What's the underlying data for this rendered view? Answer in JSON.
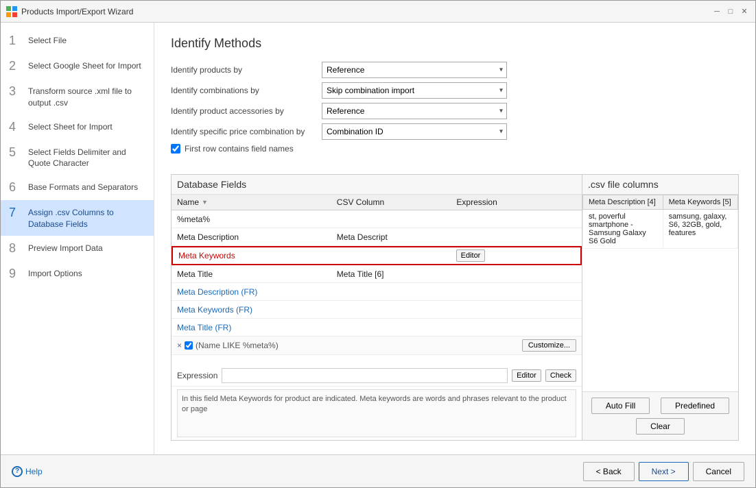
{
  "window": {
    "title": "Products Import/Export Wizard"
  },
  "sidebar": {
    "items": [
      {
        "num": "1",
        "label": "Select File",
        "active": false
      },
      {
        "num": "2",
        "label": "Select Google Sheet for Import",
        "active": false
      },
      {
        "num": "3",
        "label": "Transform source .xml file to output .csv",
        "active": false
      },
      {
        "num": "4",
        "label": "Select Sheet for Import",
        "active": false
      },
      {
        "num": "5",
        "label": "Select Fields Delimiter and Quote Character",
        "active": false
      },
      {
        "num": "6",
        "label": "Base Formats and Separators",
        "active": false
      },
      {
        "num": "7",
        "label": "Assign .csv Columns to Database Fields",
        "active": true
      },
      {
        "num": "8",
        "label": "Preview Import Data",
        "active": false
      },
      {
        "num": "9",
        "label": "Import Options",
        "active": false
      }
    ]
  },
  "main": {
    "page_title": "Identify Methods",
    "form": {
      "row1_label": "Identify products by",
      "row1_value": "Reference",
      "row2_label": "Identify combinations by",
      "row2_value": "Skip combination import",
      "row3_label": "Identify product accessories by",
      "row3_value": "Reference",
      "row4_label": "Identify specific price combination by",
      "row4_value": "Combination ID",
      "checkbox_label": "First row contains field names",
      "checkbox_checked": true
    },
    "db_panel": {
      "title": "Database Fields",
      "col_name": "Name",
      "col_csv": "CSV Column",
      "col_expr": "Expression",
      "rows": [
        {
          "name": "%meta%",
          "csv": "",
          "expr": "",
          "color": "black",
          "selected": false
        },
        {
          "name": "Meta Description",
          "csv": "Meta Descript",
          "expr": "",
          "color": "black",
          "selected": false
        },
        {
          "name": "Meta Keywords",
          "csv": "",
          "expr": "Editor",
          "color": "red",
          "selected": true
        },
        {
          "name": "Meta Title",
          "csv": "Meta Title [6]",
          "expr": "",
          "color": "black",
          "selected": false
        },
        {
          "name": "Meta Description (FR)",
          "csv": "",
          "expr": "",
          "color": "blue",
          "selected": false
        },
        {
          "name": "Meta Keywords (FR)",
          "csv": "",
          "expr": "",
          "color": "blue",
          "selected": false
        },
        {
          "name": "Meta Title (FR)",
          "csv": "",
          "expr": "",
          "color": "blue",
          "selected": false
        }
      ],
      "filter_x": "×",
      "filter_check": true,
      "filter_text": "(Name LIKE %meta%)",
      "customize_btn": "Customize...",
      "expr_label": "Expression",
      "editor_btn": "Editor",
      "check_btn": "Check",
      "description": "In this field Meta Keywords for product are indicated. Meta keywords are words and phrases relevant to the product or page"
    },
    "csv_panel": {
      "title": ".csv file columns",
      "columns": [
        "Meta Description [4]",
        "Meta Keywords [5]"
      ],
      "rows": [
        [
          "st, poverful smartphone - Samsung Galaxy S6 Gold",
          "samsung, galaxy, S6, 32GB, gold, features"
        ]
      ]
    },
    "csv_actions": {
      "auto_fill": "Auto Fill",
      "predefined": "Predefined",
      "clear": "Clear"
    },
    "bottom": {
      "help": "Help",
      "back": "< Back",
      "next": "Next >",
      "cancel": "Cancel"
    }
  }
}
